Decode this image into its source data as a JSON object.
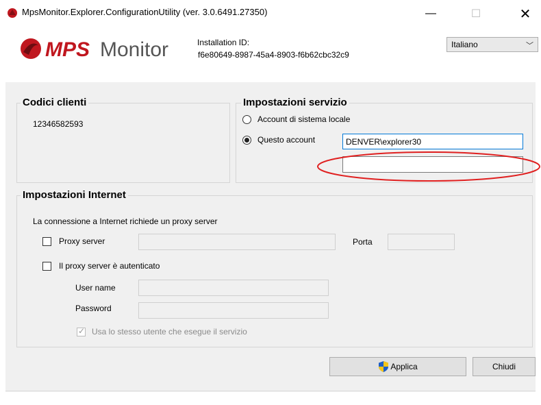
{
  "window": {
    "title": "MpsMonitor.Explorer.ConfigurationUtility (ver. 3.0.6491.27350)",
    "minimize_glyph": "—",
    "maximize_glyph": "☐",
    "close_glyph": "✕"
  },
  "header": {
    "logo_text": "MPS Monitor",
    "installation_label": "Installation ID:",
    "installation_id": "f6e80649-8987-45a4-8903-f6b62cbc32c9",
    "language": "Italiano"
  },
  "clients": {
    "title": "Codici clienti",
    "code": "12346582593"
  },
  "service": {
    "title": "Impostazioni servizio",
    "option_local": "Account di sistema locale",
    "option_this": "Questo account",
    "selected": "this",
    "account_value": "DENVER\\explorer30",
    "password_value": ""
  },
  "internet": {
    "title": "Impostazioni Internet",
    "note": "La connessione a Internet richiede un proxy server",
    "proxy_label": "Proxy server",
    "proxy_checked": false,
    "porta_label": "Porta",
    "auth_label": "Il proxy server è autenticato",
    "auth_checked": false,
    "username_label": "User name",
    "password_label": "Password",
    "same_user_label": "Usa lo stesso utente che esegue il servizio",
    "same_user_checked": true
  },
  "buttons": {
    "apply": "Applica",
    "close": "Chiudi"
  },
  "colors": {
    "panel_bg": "#f0f0f0",
    "focus_border": "#0078d7",
    "highlight_ellipse": "#e02020",
    "logo_red": "#c0171f"
  }
}
